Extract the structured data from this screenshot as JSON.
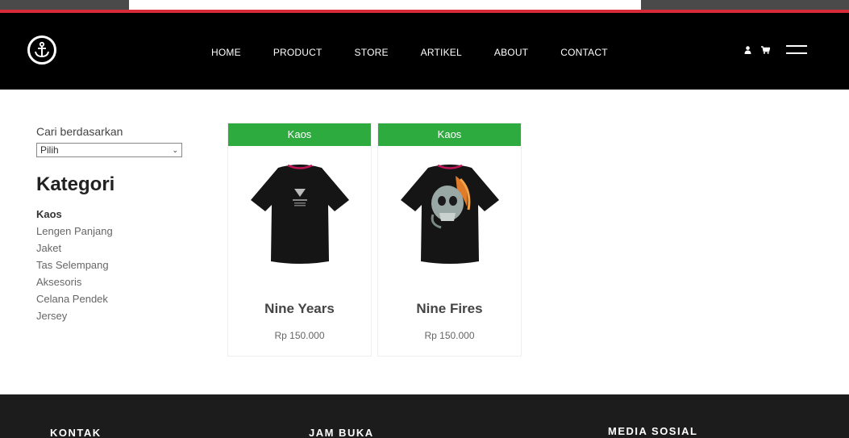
{
  "nav": {
    "items": [
      {
        "label": "HOME"
      },
      {
        "label": "PRODUCT"
      },
      {
        "label": "STORE"
      },
      {
        "label": "ARTIKEL"
      },
      {
        "label": "ABOUT"
      },
      {
        "label": "CONTACT"
      }
    ]
  },
  "header": {
    "icons": [
      "anchor-logo-icon",
      "user-icon",
      "cart-icon",
      "menu-icon"
    ]
  },
  "sidebar": {
    "search_label": "Cari berdasarkan",
    "select_value": "Pilih",
    "category_title": "Kategori",
    "categories": [
      {
        "label": "Kaos",
        "active": true
      },
      {
        "label": "Lengen Panjang"
      },
      {
        "label": "Jaket"
      },
      {
        "label": "Tas Selempang"
      },
      {
        "label": "Aksesoris"
      },
      {
        "label": "Celana Pendek"
      },
      {
        "label": "Jersey"
      }
    ]
  },
  "products": [
    {
      "tag": "Kaos",
      "name": "Nine Years",
      "price": "Rp 150.000"
    },
    {
      "tag": "Kaos",
      "name": "Nine Fires",
      "price": "Rp 150.000"
    }
  ],
  "footer": {
    "headings": [
      "KONTAK",
      "JAM BUKA",
      "MEDIA SOSIAL"
    ]
  },
  "colors": {
    "header_bg": "#000000",
    "accent_red": "#d72b3a",
    "tag_green": "#2eab3e",
    "footer_bg": "#1c1c1c"
  }
}
